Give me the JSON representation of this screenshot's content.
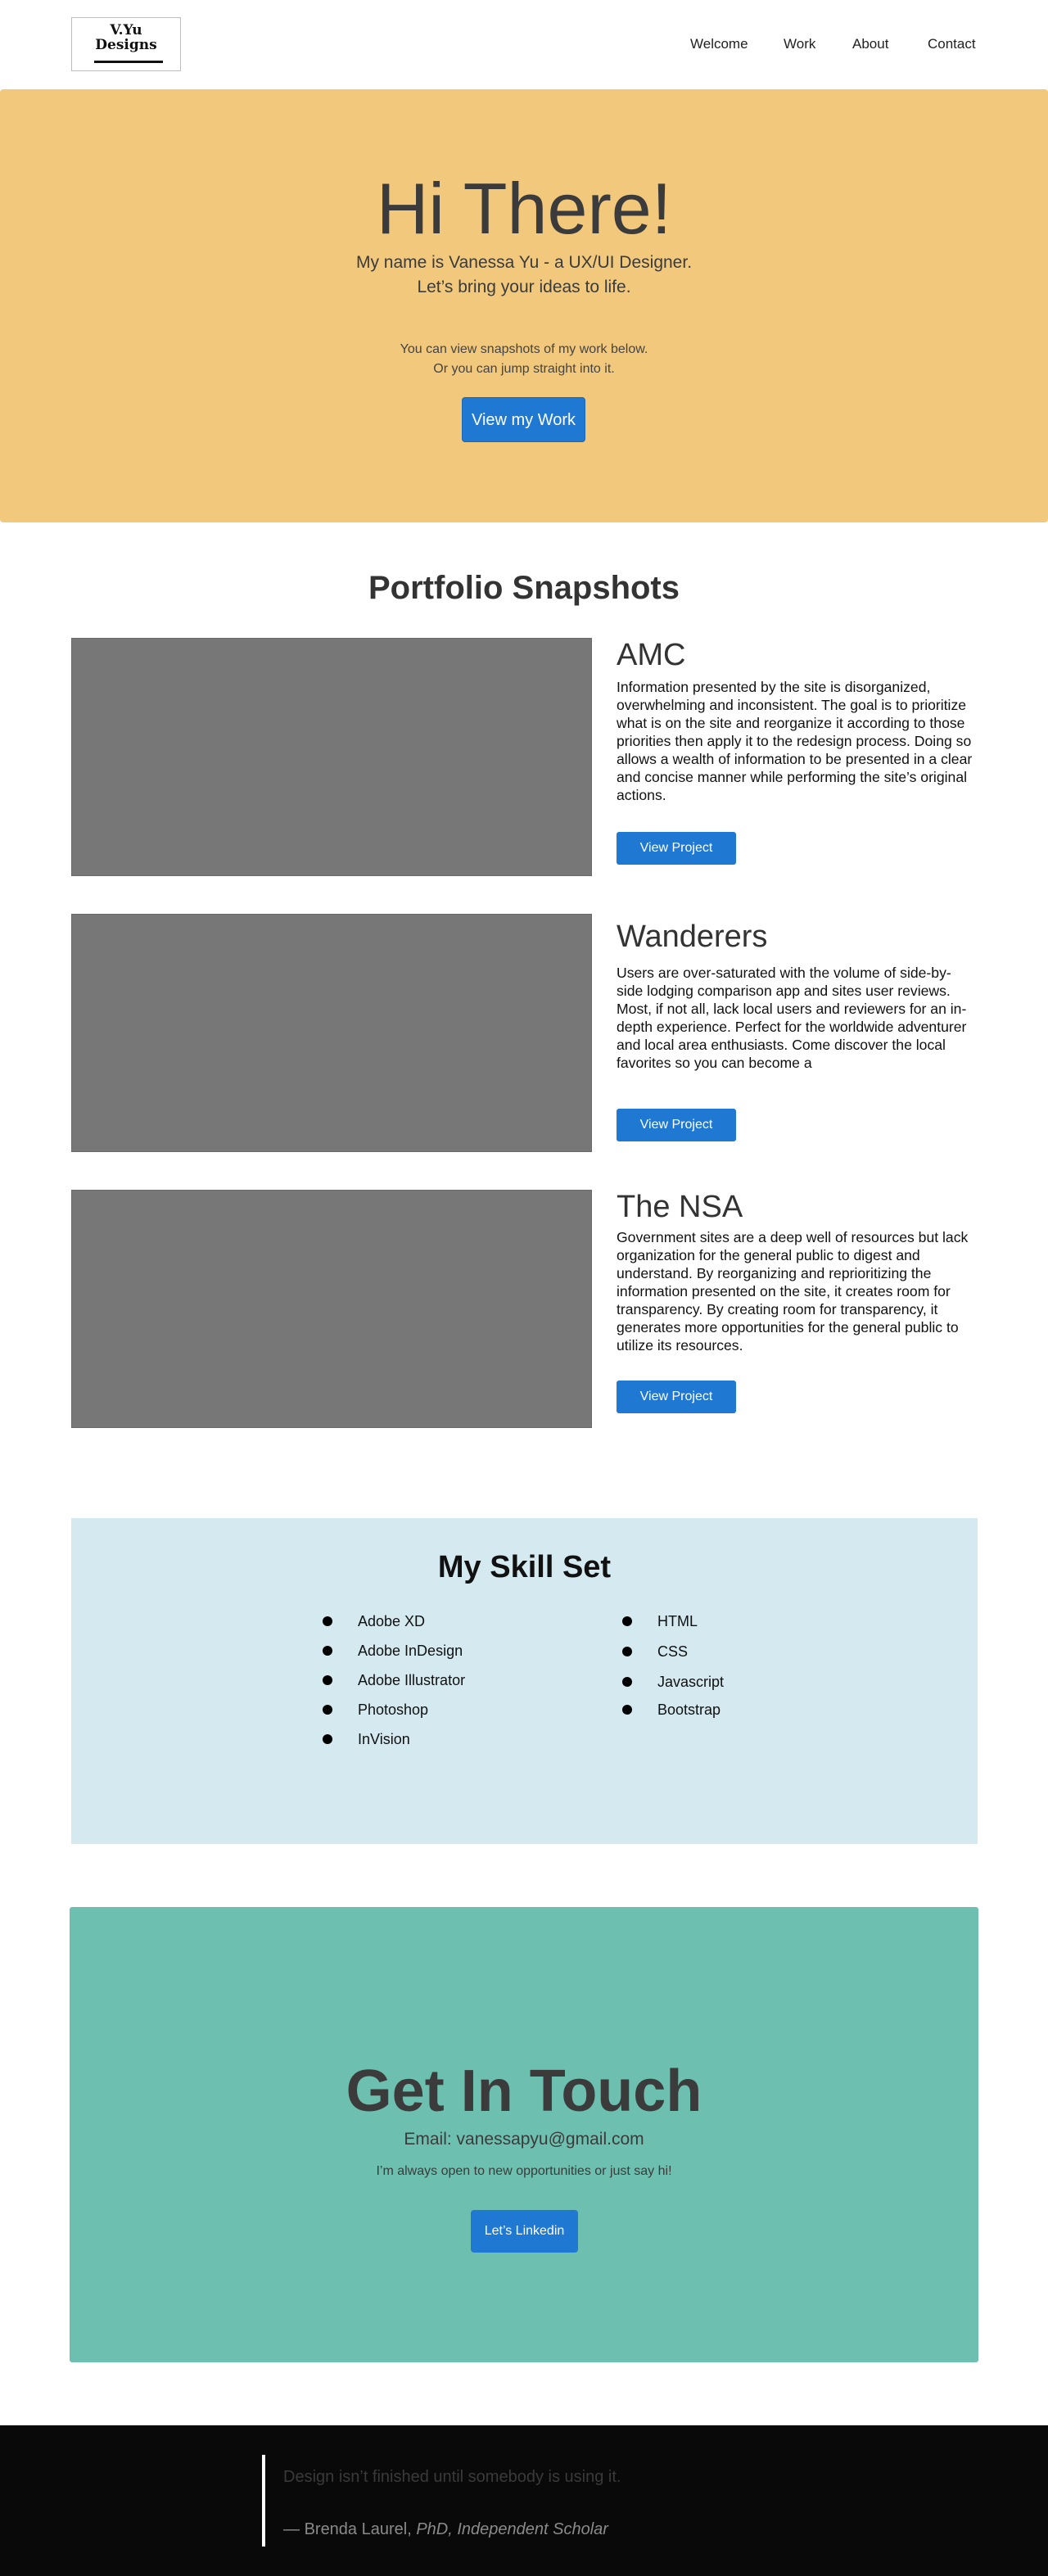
{
  "header": {
    "logo_line1": "V.Yu",
    "logo_line2": "Designs",
    "nav": [
      "Welcome",
      "Work",
      "About",
      "Contact"
    ]
  },
  "hero": {
    "title": "Hi There!",
    "intro_line1": "My name is Vanessa Yu - a UX/UI Designer.",
    "intro_line2": "Let’s bring your ideas to life.",
    "note_line1": "You can view snapshots of my work below.",
    "note_line2": "Or you can jump straight into it.",
    "button": "View my Work",
    "background": "#f2c87c"
  },
  "portfolio": {
    "title": "Portfolio Snapshots",
    "projects": [
      {
        "title": "AMC",
        "description": "Information presented by the site is disorganized, overwhelming and inconsistent. The goal is to prioritize what is on the site and reorganize it according to those priorities then apply it to the redesign process. Doing so allows a wealth of information to be presented in a clear and concise manner while performing the site’s original actions.",
        "button": "View Project"
      },
      {
        "title": "Wanderers",
        "description": "Users are over-saturated with the volume of side-by-side lodging comparison app and sites user reviews. Most, if not all, lack local users and reviewers for an in-depth experience. Perfect for the worldwide adventurer and local area enthusiasts. Come discover the local favorites so you can become a",
        "button": "View Project"
      },
      {
        "title": "The NSA",
        "description": "Government sites are a deep well of resources but lack organization for the general public to digest and understand. By reorganizing and reprioritizing the information presented on the site, it creates room for transparency. By creating room for transparency, it generates more opportunities for the general public to utilize its resources.",
        "button": "View Project"
      }
    ]
  },
  "skills": {
    "title": "My Skill Set",
    "left": [
      "Adobe XD",
      "Adobe InDesign",
      "Adobe Illustrator",
      "Photoshop",
      "InVision"
    ],
    "right": [
      "HTML",
      "CSS",
      "Javascript",
      "Bootstrap"
    ],
    "background": "#d4eaf0"
  },
  "contact": {
    "title": "Get In Touch",
    "email": "Email: vanessapyu@gmail.com",
    "note": "I’m always open to new opportunities or just say hi!",
    "button": "Let’s Linkedin",
    "background": "#6dbfaf"
  },
  "footer": {
    "quote": "Design isn’t finished until somebody is using it.",
    "dash": "—",
    "author": "Brenda Laurel,",
    "role": "PhD, Independent Scholar"
  },
  "colors": {
    "accent": "#1f78d1",
    "image_placeholder": "#777777"
  }
}
